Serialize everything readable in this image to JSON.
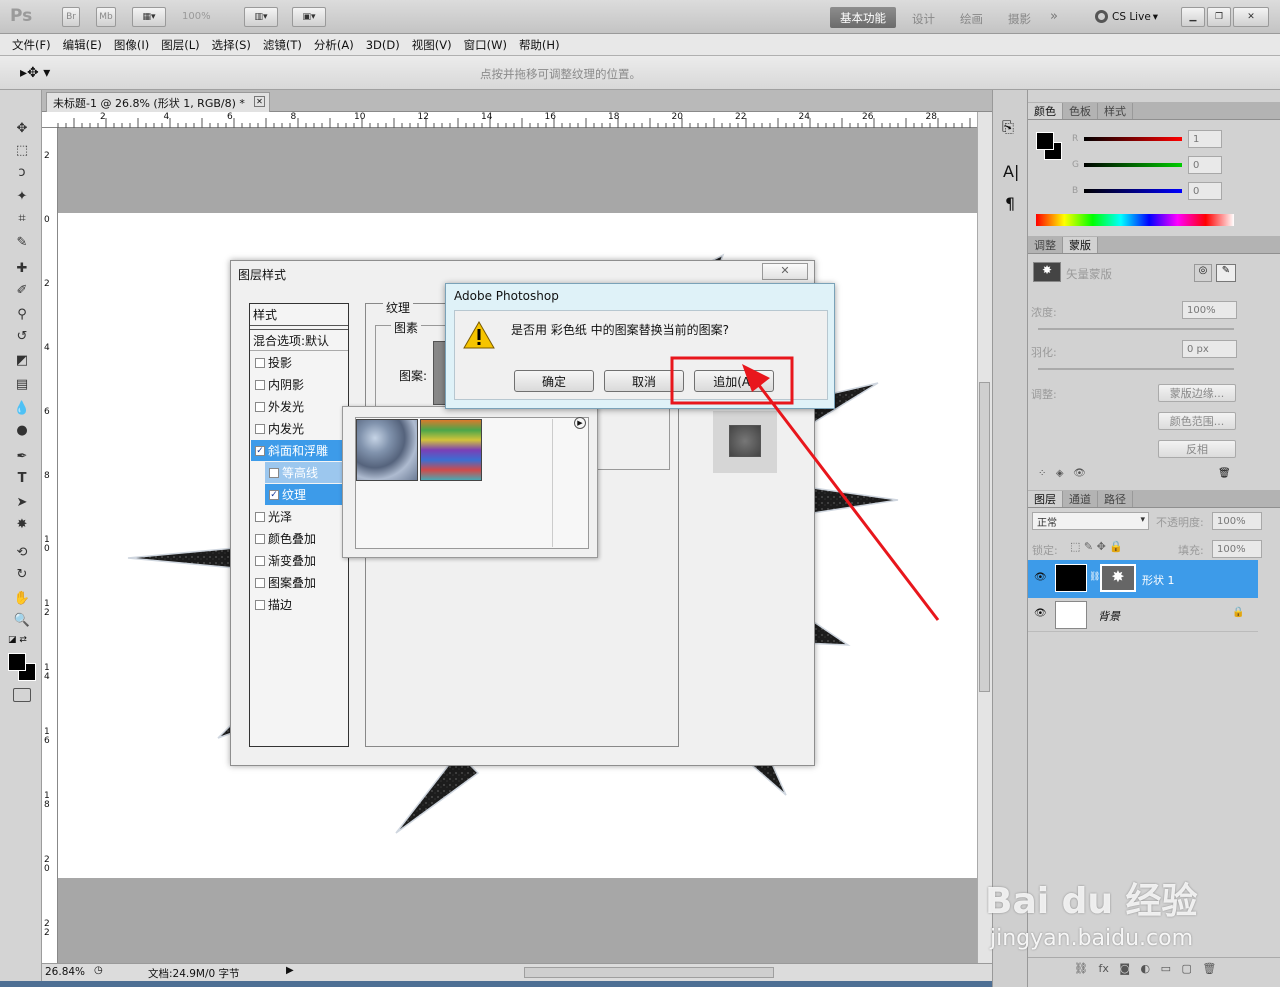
{
  "app": {
    "logo": "Ps",
    "bridge": "Br",
    "mini_bridge": "Mb",
    "zoom_display": "100%"
  },
  "workspaces": {
    "active": "基本功能",
    "design": "设计",
    "painting": "绘画",
    "photography": "摄影",
    "more": "»",
    "cs_live": "CS Live"
  },
  "menu": [
    "文件(F)",
    "编辑(E)",
    "图像(I)",
    "图层(L)",
    "选择(S)",
    "滤镜(T)",
    "分析(A)",
    "3D(D)",
    "视图(V)",
    "窗口(W)",
    "帮助(H)"
  ],
  "options_bar": {
    "hint": "点按并拖移可调整纹理的位置。"
  },
  "document": {
    "tab_title": "未标题-1 @ 26.8% (形状 1, RGB/8) *"
  },
  "ruler": {
    "top_ticks": [
      "2",
      "4",
      "6",
      "8",
      "10",
      "12",
      "14",
      "16",
      "18",
      "20",
      "22",
      "24",
      "26",
      "28"
    ],
    "left_ticks": [
      "2",
      "0",
      "2",
      "4",
      "6",
      "8",
      "10",
      "12",
      "14",
      "16",
      "18",
      "20",
      "22"
    ]
  },
  "status": {
    "zoom": "26.84%",
    "doc_info": "文档:24.9M/0 字节"
  },
  "color_panel": {
    "tabs": [
      "颜色",
      "色板",
      "样式"
    ],
    "r_label": "R",
    "g_label": "G",
    "b_label": "B",
    "r": "1",
    "g": "0",
    "b": "0"
  },
  "adjust_panel": {
    "tabs": [
      "调整",
      "蒙版"
    ],
    "mask_type": "矢量蒙版",
    "density_label": "浓度:",
    "density": "100%",
    "feather_label": "羽化:",
    "feather": "0 px",
    "refine_label": "调整:",
    "btn_mask_edge": "蒙版边缘...",
    "btn_color_range": "颜色范围...",
    "btn_invert": "反相"
  },
  "layers_panel": {
    "tabs": [
      "图层",
      "通道",
      "路径"
    ],
    "blend": "正常",
    "opacity_label": "不透明度:",
    "opacity": "100%",
    "lock_label": "锁定:",
    "fill_label": "填充:",
    "fill": "100%",
    "layers": [
      {
        "name": "形状 1"
      },
      {
        "name": "背景"
      }
    ]
  },
  "layer_style": {
    "title": "图层样式",
    "styles_header": "样式",
    "blend_options": "混合选项:默认",
    "items": [
      {
        "label": "投影",
        "checked": false
      },
      {
        "label": "内阴影",
        "checked": false
      },
      {
        "label": "外发光",
        "checked": false
      },
      {
        "label": "内发光",
        "checked": false
      },
      {
        "label": "斜面和浮雕",
        "checked": true
      },
      {
        "label": "等高线",
        "checked": false
      },
      {
        "label": "纹理",
        "checked": true
      },
      {
        "label": "光泽",
        "checked": false
      },
      {
        "label": "颜色叠加",
        "checked": false
      },
      {
        "label": "渐变叠加",
        "checked": false
      },
      {
        "label": "图案叠加",
        "checked": false
      },
      {
        "label": "描边",
        "checked": false
      }
    ],
    "group_texture": "纹理",
    "group_pattern": "图素",
    "pattern_label": "图案:",
    "close_symbol": "✕"
  },
  "alert": {
    "title": "Adobe Photoshop",
    "message": "是否用 彩色纸 中的图案替换当前的图案?",
    "ok": "确定",
    "cancel": "取消",
    "append": "追加(A)"
  },
  "watermark": {
    "brand": "Bai du 经验",
    "url": "jingyan.baidu.com"
  },
  "colors": {
    "highlight": "#3d9be9",
    "annotation": "#e8161c"
  }
}
